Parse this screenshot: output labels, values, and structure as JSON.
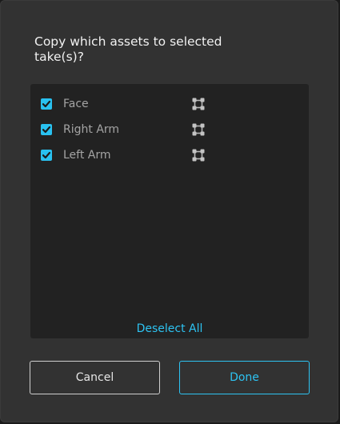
{
  "dialog": {
    "title": "Copy which assets to selected take(s)?"
  },
  "assets": [
    {
      "label": "Face",
      "checked": true,
      "icon": "asset-node-icon"
    },
    {
      "label": "Right Arm",
      "checked": true,
      "icon": "asset-node-icon"
    },
    {
      "label": "Left Arm",
      "checked": true,
      "icon": "asset-node-icon"
    }
  ],
  "list": {
    "deselect_label": "Deselect All"
  },
  "buttons": {
    "cancel_label": "Cancel",
    "done_label": "Done"
  },
  "colors": {
    "accent": "#2dc3f2",
    "checkbox": "#29c1f0",
    "dialog_bg": "#323232",
    "list_bg": "#222222"
  }
}
